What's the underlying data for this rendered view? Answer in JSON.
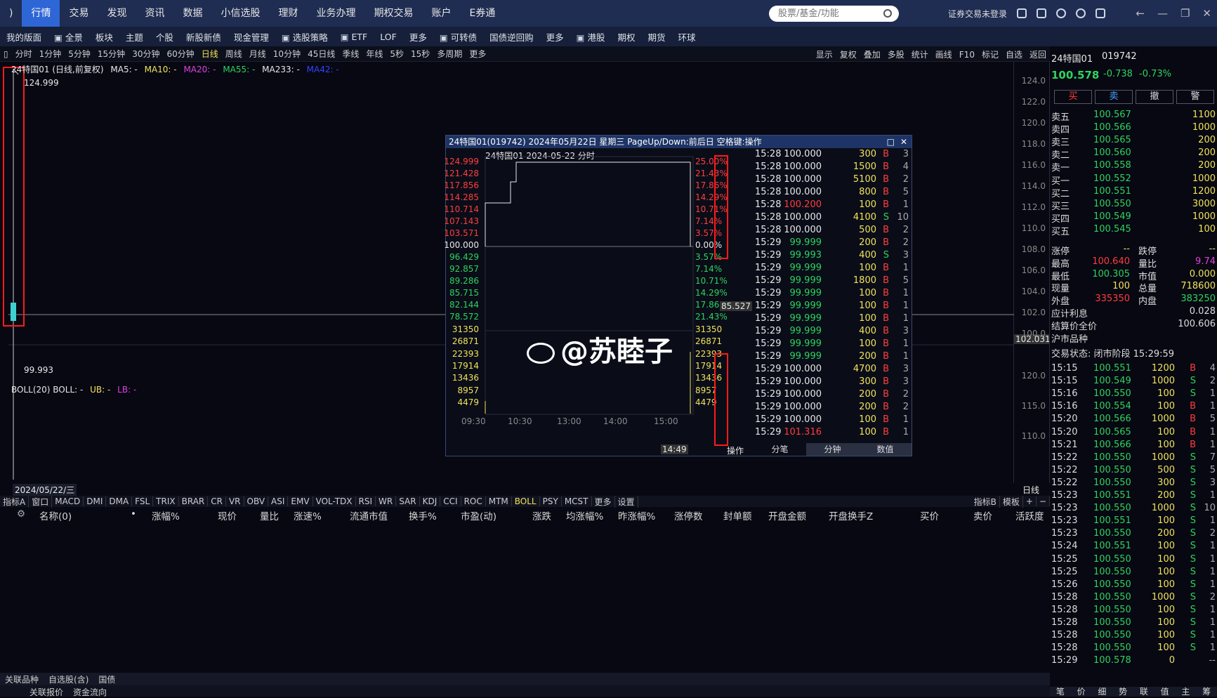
{
  "nav": {
    "items": [
      ")",
      "行情",
      "交易",
      "发现",
      "资讯",
      "数据",
      "小信选股",
      "理财",
      "业务办理",
      "期权交易",
      "账户",
      "E券通"
    ],
    "search_placeholder": "股票/基金/功能",
    "login_status": "证券交易未登录"
  },
  "toolbar2": [
    "我的版面",
    "全景",
    "板块",
    "主题",
    "个股",
    "新股新债",
    "现金管理",
    "选股策略",
    "ETF",
    "LOF",
    "更多",
    "可转债",
    "国债逆回购",
    "更多",
    "港股",
    "期权",
    "期货",
    "环球"
  ],
  "periods": [
    "分时",
    "1分钟",
    "5分钟",
    "15分钟",
    "30分钟",
    "60分钟",
    "日线",
    "周线",
    "月线",
    "10分钟",
    "45日线",
    "季线",
    "年线",
    "5秒",
    "15秒",
    "多周期",
    "更多"
  ],
  "period_selected": "日线",
  "chart_tools": [
    "显示",
    "复权",
    "叠加",
    "多股",
    "统计",
    "画线",
    "F10",
    "标记",
    "自选",
    "返回"
  ],
  "legend": {
    "name": "24特国01 (日线,前复权)",
    "ma5": "MA5: -",
    "ma10": "MA10: -",
    "ma20": "MA20: -",
    "ma55": "MA55: -",
    "ma233": "MA233: -",
    "ma42": "MA42: -",
    "boll": "BOLL(20)  BOLL: -",
    "ub": "UB: -",
    "lb": "LB: -"
  },
  "main_chart": {
    "high_label": "124.999",
    "low_label": "99.993",
    "date_label": "2024/05/22/三",
    "price_marker": "102.031",
    "period_tag": "日线"
  },
  "y_ticks": [
    "124.0",
    "122.0",
    "120.0",
    "118.0",
    "116.0",
    "114.0",
    "112.0",
    "110.0",
    "108.0",
    "106.0",
    "104.0",
    "102.0",
    "100.0"
  ],
  "sub_ticks": [
    "120.0",
    "115.0",
    "110.0"
  ],
  "popup": {
    "title": "24特国01(019742) 2024年05月22日 星期三 PageUp/Down:前后日 空格键:操作",
    "chart_title": "24特国01  2024-05-22 分时",
    "left_prices": [
      "124.999",
      "121.428",
      "117.856",
      "114.285",
      "110.714",
      "107.143",
      "103.571",
      "100.000",
      "96.429",
      "92.857",
      "89.286",
      "85.715",
      "82.144",
      "78.572"
    ],
    "right_pct": [
      "25.00%",
      "21.43%",
      "17.86%",
      "14.29%",
      "10.71%",
      "7.14%",
      "3.57%",
      "0.00%",
      "3.57%",
      "7.14%",
      "10.71%",
      "14.29%",
      "17.86%",
      "21.43%"
    ],
    "vol_ticks": [
      "31350",
      "26871",
      "22393",
      "17914",
      "13436",
      "8957",
      "4479"
    ],
    "time_ticks": [
      "09:30",
      "10:30",
      "13:00",
      "14:00",
      "15:00"
    ],
    "cursor_time": "14:49",
    "cursor_price": "85.527",
    "op_label": "操作",
    "tabs": [
      "分笔",
      "分钟",
      "数值"
    ],
    "trades": [
      [
        "15:28",
        "100.000",
        "300",
        "B",
        "3"
      ],
      [
        "15:28",
        "100.000",
        "1500",
        "B",
        "4"
      ],
      [
        "15:28",
        "100.000",
        "5100",
        "B",
        "2"
      ],
      [
        "15:28",
        "100.000",
        "800",
        "B",
        "5"
      ],
      [
        "15:28",
        "100.200",
        "100",
        "B",
        "1"
      ],
      [
        "15:28",
        "100.000",
        "4100",
        "S",
        "10"
      ],
      [
        "15:28",
        "100.000",
        "500",
        "B",
        "2"
      ],
      [
        "15:29",
        "99.999",
        "200",
        "B",
        "2"
      ],
      [
        "15:29",
        "99.993",
        "400",
        "S",
        "3"
      ],
      [
        "15:29",
        "99.999",
        "100",
        "B",
        "1"
      ],
      [
        "15:29",
        "99.999",
        "1800",
        "B",
        "5"
      ],
      [
        "15:29",
        "99.999",
        "100",
        "B",
        "1"
      ],
      [
        "15:29",
        "99.999",
        "100",
        "B",
        "1"
      ],
      [
        "15:29",
        "99.999",
        "100",
        "B",
        "1"
      ],
      [
        "15:29",
        "99.999",
        "400",
        "B",
        "3"
      ],
      [
        "15:29",
        "99.999",
        "100",
        "B",
        "1"
      ],
      [
        "15:29",
        "99.999",
        "200",
        "B",
        "1"
      ],
      [
        "15:29",
        "100.000",
        "4700",
        "B",
        "3"
      ],
      [
        "15:29",
        "100.000",
        "300",
        "B",
        "3"
      ],
      [
        "15:29",
        "100.000",
        "200",
        "B",
        "2"
      ],
      [
        "15:29",
        "100.000",
        "200",
        "B",
        "2"
      ],
      [
        "15:29",
        "100.000",
        "100",
        "B",
        "1"
      ],
      [
        "15:29",
        "101.316",
        "100",
        "B",
        "1"
      ]
    ]
  },
  "watermark": "@苏睦子",
  "quote": {
    "name": "24特国01",
    "code": "019742",
    "price": "100.578",
    "change": "-0.738",
    "pct": "-0.73%",
    "actions": [
      "买",
      "卖",
      "撤",
      "警"
    ],
    "asks": [
      [
        "卖五",
        "100.567",
        "1100"
      ],
      [
        "卖四",
        "100.566",
        "1000"
      ],
      [
        "卖三",
        "100.565",
        "200"
      ],
      [
        "卖二",
        "100.560",
        "200"
      ],
      [
        "卖一",
        "100.558",
        "200"
      ]
    ],
    "bids": [
      [
        "买一",
        "100.552",
        "1000"
      ],
      [
        "买二",
        "100.551",
        "1200"
      ],
      [
        "买三",
        "100.550",
        "3000"
      ],
      [
        "买四",
        "100.549",
        "1000"
      ],
      [
        "买五",
        "100.545",
        "100"
      ]
    ],
    "stats": [
      [
        "涨停",
        "--",
        "跌停",
        "--"
      ],
      [
        "最高",
        "100.640",
        "量比",
        "9.74"
      ],
      [
        "最低",
        "100.305",
        "市值",
        "0.000"
      ],
      [
        "现量",
        "100",
        "总量",
        "718600"
      ],
      [
        "外盘",
        "335350",
        "内盘",
        "383250"
      ]
    ],
    "interest_label": "应计利息",
    "interest": "0.028",
    "settle_label": "结算价全价",
    "settle": "100.606",
    "market": "沪市品种",
    "status": "交易状态: 闭市阶段 15:29:59",
    "ticks": [
      [
        "15:15",
        "100.551",
        "1200",
        "B",
        "4"
      ],
      [
        "15:15",
        "100.549",
        "1000",
        "S",
        "2"
      ],
      [
        "15:16",
        "100.550",
        "100",
        "S",
        "1"
      ],
      [
        "15:16",
        "100.554",
        "100",
        "B",
        "1"
      ],
      [
        "15:20",
        "100.566",
        "1000",
        "B",
        "5"
      ],
      [
        "15:20",
        "100.565",
        "100",
        "B",
        "1"
      ],
      [
        "15:21",
        "100.566",
        "100",
        "B",
        "1"
      ],
      [
        "15:22",
        "100.550",
        "1000",
        "S",
        "7"
      ],
      [
        "15:22",
        "100.550",
        "500",
        "S",
        "5"
      ],
      [
        "15:22",
        "100.550",
        "300",
        "S",
        "3"
      ],
      [
        "15:23",
        "100.551",
        "200",
        "S",
        "1"
      ],
      [
        "15:23",
        "100.550",
        "1000",
        "S",
        "10"
      ],
      [
        "15:23",
        "100.551",
        "100",
        "S",
        "1"
      ],
      [
        "15:23",
        "100.550",
        "200",
        "S",
        "2"
      ],
      [
        "15:24",
        "100.551",
        "100",
        "S",
        "1"
      ],
      [
        "15:25",
        "100.550",
        "100",
        "S",
        "1"
      ],
      [
        "15:25",
        "100.550",
        "100",
        "S",
        "1"
      ],
      [
        "15:26",
        "100.550",
        "100",
        "S",
        "1"
      ],
      [
        "15:28",
        "100.550",
        "1000",
        "S",
        "2"
      ],
      [
        "15:28",
        "100.550",
        "100",
        "S",
        "1"
      ],
      [
        "15:28",
        "100.550",
        "100",
        "S",
        "1"
      ],
      [
        "15:28",
        "100.550",
        "100",
        "S",
        "1"
      ],
      [
        "15:28",
        "100.550",
        "100",
        "S",
        "1"
      ],
      [
        "15:29",
        "100.578",
        "0",
        "",
        "--"
      ]
    ],
    "bottom_tabs": [
      "笔",
      "价",
      "细",
      "势",
      "联",
      "值",
      "主",
      "筹"
    ]
  },
  "indicator_tabs": [
    "指标A",
    "窗口",
    "MACD",
    "DMI",
    "DMA",
    "FSL",
    "TRIX",
    "BRAR",
    "CR",
    "VR",
    "OBV",
    "ASI",
    "EMV",
    "VOL-TDX",
    "RSI",
    "WR",
    "SAR",
    "KDJ",
    "CCI",
    "ROC",
    "MTM",
    "BOLL",
    "PSY",
    "MCST",
    "更多",
    "设置"
  ],
  "indicator_selected": "BOLL",
  "indicator_right": [
    "指标B",
    "模板",
    "+",
    "−"
  ],
  "columns": [
    "名称(0)",
    "•",
    "涨幅%",
    "现价",
    "量比",
    "涨速%",
    "流通市值",
    "换手%",
    "市盈(动)",
    "涨跌",
    "均涨幅%",
    "昨涨幅%",
    "涨停数",
    "封单额",
    "开盘金额",
    "开盘换手Z",
    "买价",
    "卖价",
    "活跃度"
  ],
  "bottom_tabs": [
    "关联品种",
    "自选股(含)",
    "国债"
  ],
  "bottom2": [
    "关联报价",
    "资金流向"
  ]
}
